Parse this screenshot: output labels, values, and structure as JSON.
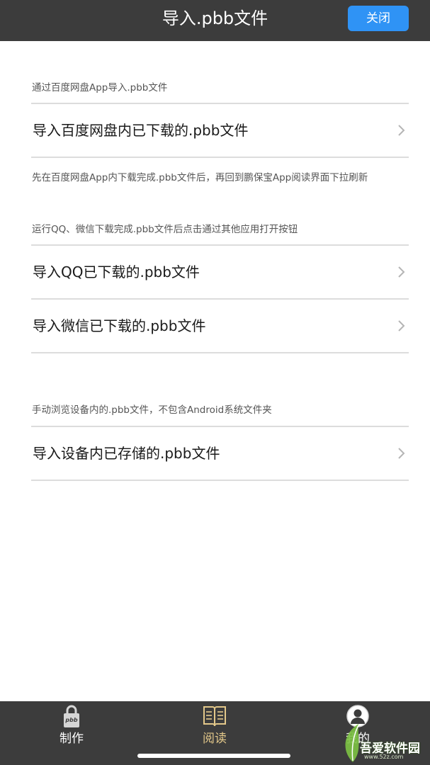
{
  "header": {
    "title": "导入.pbb文件",
    "close_label": "关闭"
  },
  "sections": [
    {
      "hint": "通过百度网盘App导入.pbb文件",
      "rows": [
        "导入百度网盘内已下载的.pbb文件"
      ],
      "footer": "先在百度网盘App内下载完成.pbb文件后，再回到鹏保宝App阅读界面下拉刷新"
    },
    {
      "hint": "运行QQ、微信下载完成.pbb文件后点击通过其他应用打开按钮",
      "rows": [
        "导入QQ已下载的.pbb文件",
        "导入微信已下载的.pbb文件"
      ]
    },
    {
      "hint": "手动浏览设备内的.pbb文件，不包含Android系统文件夹",
      "rows": [
        "导入设备内已存储的.pbb文件"
      ]
    }
  ],
  "tabbar": {
    "items": [
      {
        "label": "制作",
        "icon": "lock-pbb-icon",
        "active": false
      },
      {
        "label": "阅读",
        "icon": "open-book-icon",
        "active": true
      },
      {
        "label": "我的",
        "icon": "user-avatar-icon",
        "active": false
      }
    ],
    "lock_icon_text": "pbb"
  },
  "watermark": {
    "text": "吾爱软件园",
    "sub": "www.52z.com"
  },
  "colors": {
    "header_bg": "#3c3c3c",
    "accent_button": "#2f93f5",
    "active_tab": "#e3c88a"
  }
}
